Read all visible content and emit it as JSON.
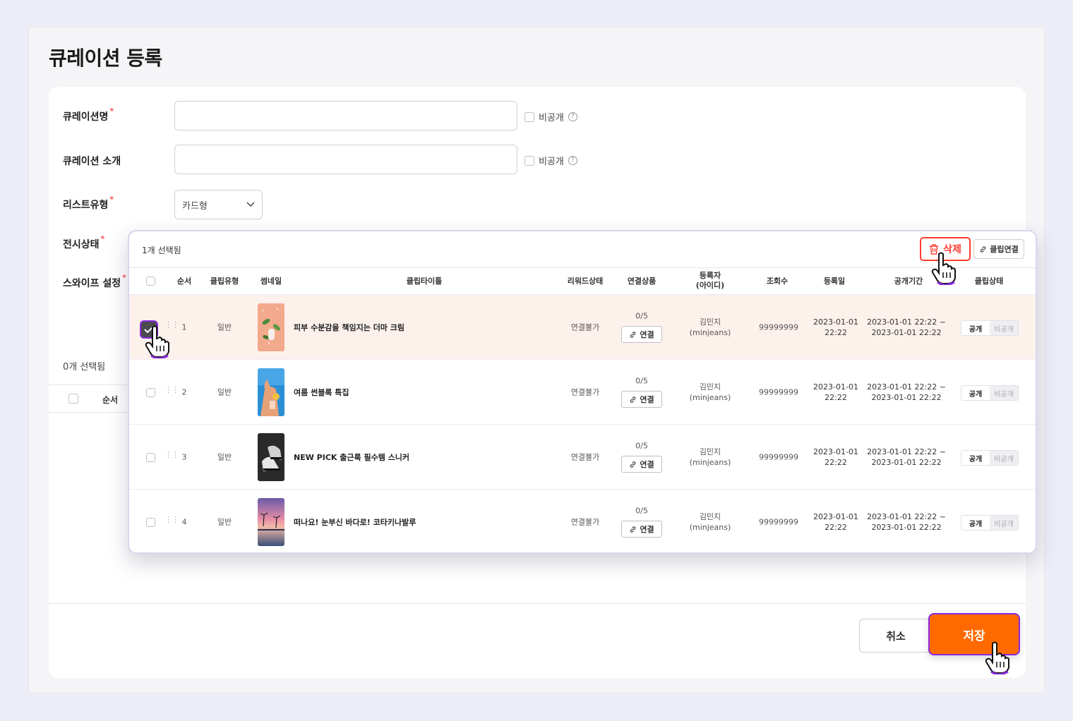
{
  "page": {
    "title": "큐레이션 등록"
  },
  "form": {
    "name_label": "큐레이션명",
    "intro_label": "큐레이션 소개",
    "list_type_label": "리스트유형",
    "display_state_label": "전시상태",
    "swipe_label": "스와이프 설정",
    "required_mark": "*",
    "private_label": "비공개",
    "help_glyph": "?",
    "list_type_value": "카드형",
    "selected_count": "0개 선택됨",
    "order_header": "순서"
  },
  "popup": {
    "selected_count": "1개 선택됨",
    "delete_label": "삭제",
    "clip_connect_label": "클립연결",
    "headers": {
      "order": "순서",
      "clip_type": "클립유형",
      "thumbnail": "썸네일",
      "clip_title": "클립타이틀",
      "reward_status": "리워드상태",
      "linked_products": "연결상품",
      "registrant_line1": "등록자",
      "registrant_line2": "(아이디)",
      "views": "조회수",
      "reg_date": "등록일",
      "public_period": "공개기간",
      "clip_status": "클립상태"
    },
    "rows": [
      {
        "order": "1",
        "type": "일반",
        "title": "피부 수분감을 책임지는 더마 크림",
        "reward": "연결불가",
        "products": "0/5",
        "link_label": "연결",
        "reg_name": "김민지",
        "reg_id": "(minjeans)",
        "views": "99999999",
        "date_line1": "2023-01-01",
        "date_line2": "22:22",
        "period_line1": "2023-01-01 22:22 ~",
        "period_line2": "2023-01-01 22:22",
        "public_label": "공개",
        "private_label": "비공개",
        "checked": true
      },
      {
        "order": "2",
        "type": "일반",
        "title": "여름 썬블록 특집",
        "reward": "연결불가",
        "products": "0/5",
        "link_label": "연결",
        "reg_name": "김민지",
        "reg_id": "(minjeans)",
        "views": "99999999",
        "date_line1": "2023-01-01",
        "date_line2": "22:22",
        "period_line1": "2023-01-01 22:22 ~",
        "period_line2": "2023-01-01 22:22",
        "public_label": "공개",
        "private_label": "비공개",
        "checked": false
      },
      {
        "order": "3",
        "type": "일반",
        "title": "NEW PICK 출근룩 필수템 스니커",
        "reward": "연결불가",
        "products": "0/5",
        "link_label": "연결",
        "reg_name": "김민지",
        "reg_id": "(minjeans)",
        "views": "99999999",
        "date_line1": "2023-01-01",
        "date_line2": "22:22",
        "period_line1": "2023-01-01 22:22 ~",
        "period_line2": "2023-01-01 22:22",
        "public_label": "공개",
        "private_label": "비공개",
        "checked": false
      },
      {
        "order": "4",
        "type": "일반",
        "title": "떠나요! 눈부신 바다로! 코타키나발루",
        "reward": "연결불가",
        "products": "0/5",
        "link_label": "연결",
        "reg_name": "김민지",
        "reg_id": "(minjeans)",
        "views": "99999999",
        "date_line1": "2023-01-01",
        "date_line2": "22:22",
        "period_line1": "2023-01-01 22:22 ~",
        "period_line2": "2023-01-01 22:22",
        "public_label": "공개",
        "private_label": "비공개",
        "checked": false
      }
    ]
  },
  "footer": {
    "cancel_label": "취소",
    "save_label": "저장"
  },
  "colors": {
    "accent": "#ff6a00",
    "highlight": "#8a2be2",
    "danger": "#ff3b30",
    "selected_row": "#fdf1ec"
  },
  "icons": {
    "trash": "trash-icon",
    "link": "link-icon",
    "cursor": "hand-pointer-icon",
    "check": "check-icon",
    "chevron": "chevron-down-icon",
    "drag": "drag-handle-icon"
  }
}
